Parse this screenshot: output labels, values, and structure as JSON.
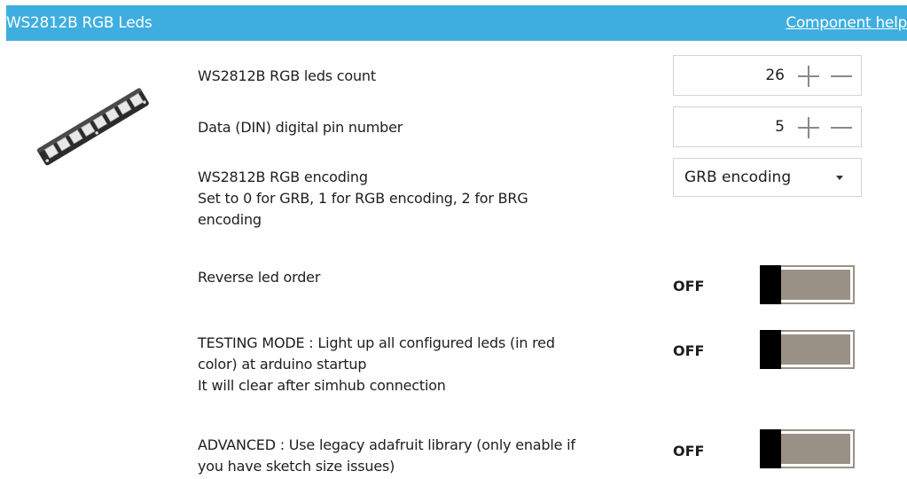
{
  "header": {
    "title": "WS2812B RGB Leds",
    "help_link": "Component help"
  },
  "led_count": {
    "label": "WS2812B RGB leds count",
    "value": "26"
  },
  "data_pin": {
    "label": "Data (DIN) digital pin number",
    "value": "5"
  },
  "encoding": {
    "label_line1": "WS2812B RGB encoding",
    "label_line2": "Set to 0 for GRB, 1 for RGB encoding, 2 for BRG",
    "label_line3": "encoding",
    "selected": "GRB encoding"
  },
  "reverse": {
    "label": "Reverse led order",
    "state": "OFF"
  },
  "testing": {
    "label_line1": "TESTING MODE : Light up all configured leds (in red",
    "label_line2": "color) at arduino startup",
    "label_line3": "It will clear after simhub connection",
    "state": "OFF"
  },
  "advanced": {
    "label_line1": "ADVANCED : Use legacy adafruit library (only enable if",
    "label_line2": "you have sketch size issues)",
    "state": "OFF"
  },
  "colors": {
    "header_bg": "#3eaee0",
    "toggle_track": "#9a9186",
    "toggle_knob": "#000000"
  }
}
